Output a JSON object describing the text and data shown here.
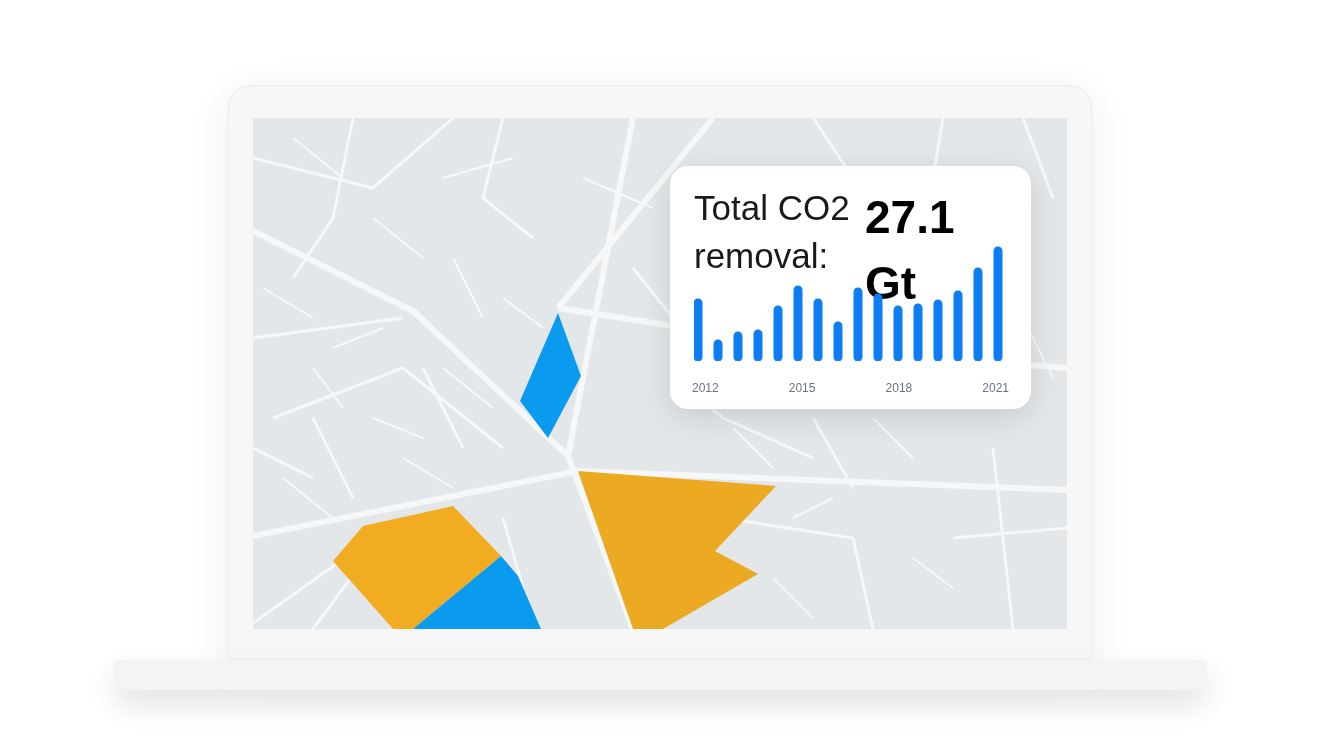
{
  "card": {
    "title": "Total CO2 removal:",
    "value": "27.1 Gt",
    "x_labels": [
      "2012",
      "2015",
      "2018",
      "2021"
    ]
  }
}
